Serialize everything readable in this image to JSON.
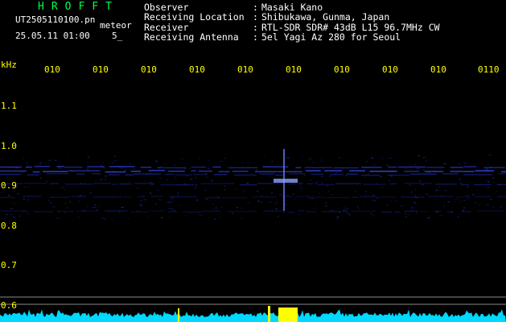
{
  "header": {
    "app_title": "HROFFT",
    "filename": "UT2505110100.pn",
    "meteor_label": "meteor",
    "datetime": "25.05.11 01:00",
    "count": "5_"
  },
  "info": [
    {
      "label": "Observer",
      "sep": ":",
      "value": "Masaki Kano"
    },
    {
      "label": "Receiving Location",
      "sep": ":",
      "value": "Shibukawa, Gunma, Japan"
    },
    {
      "label": "Receiver",
      "sep": ":",
      "value": "RTL-SDR SDR# 43dB L15 96.7MHz CW"
    },
    {
      "label": "Receiving Antenna",
      "sep": ":",
      "value": "5el Yagi Az 280 for Seoul"
    }
  ],
  "axis": {
    "unit": "kHz",
    "time_ticks": [
      "010",
      "010",
      "010",
      "010",
      "010",
      "010",
      "010",
      "010",
      "010",
      "0110"
    ],
    "freq_labels": [
      "1.1",
      "1.0",
      "0.9",
      "0.8",
      "0.7",
      "0.6"
    ]
  },
  "colors": {
    "background": "#000000",
    "title_green": "#00ff4c",
    "tick_yellow": "#ffff00",
    "text_white": "#ffffff",
    "signal_blue": "#2a3cff",
    "baseline_cyan": "#00e5ff",
    "meteor_yellow": "#ffff00"
  }
}
